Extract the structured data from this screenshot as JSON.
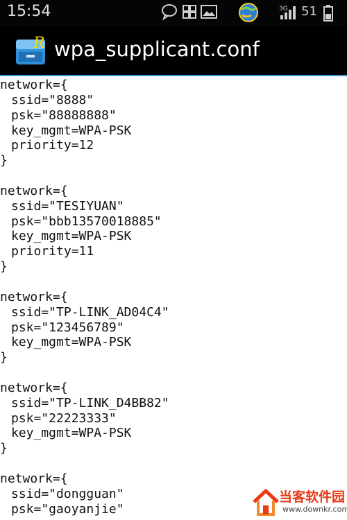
{
  "status_bar": {
    "time": "15:54",
    "icons": [
      "chat-bubble-icon",
      "app-grid-icon",
      "image-icon",
      "sync-globe-icon",
      "signal-3g-icon",
      "battery-icon"
    ],
    "network_label": "3G",
    "battery_level": "51"
  },
  "title_bar": {
    "app_icon": "file-manager-icon",
    "title": "wpa_supplicant.conf",
    "accent_color": "#3c9dd8"
  },
  "file_lines": [
    {
      "text": "network={",
      "indent": false
    },
    {
      "text": "ssid=\"8888\"",
      "indent": true
    },
    {
      "text": "psk=\"88888888\"",
      "indent": true
    },
    {
      "text": "key_mgmt=WPA-PSK",
      "indent": true
    },
    {
      "text": "priority=12",
      "indent": true
    },
    {
      "text": "}",
      "indent": false
    },
    {
      "text": "",
      "indent": false
    },
    {
      "text": "network={",
      "indent": false
    },
    {
      "text": "ssid=\"TESIYUAN\"",
      "indent": true
    },
    {
      "text": "psk=\"bbb13570018885\"",
      "indent": true
    },
    {
      "text": "key_mgmt=WPA-PSK",
      "indent": true
    },
    {
      "text": "priority=11",
      "indent": true
    },
    {
      "text": "}",
      "indent": false
    },
    {
      "text": "",
      "indent": false
    },
    {
      "text": "network={",
      "indent": false
    },
    {
      "text": "ssid=\"TP-LINK_AD04C4\"",
      "indent": true
    },
    {
      "text": "psk=\"123456789\"",
      "indent": true
    },
    {
      "text": "key_mgmt=WPA-PSK",
      "indent": true
    },
    {
      "text": "}",
      "indent": false
    },
    {
      "text": "",
      "indent": false
    },
    {
      "text": "network={",
      "indent": false
    },
    {
      "text": "ssid=\"TP-LINK_D4BB82\"",
      "indent": true
    },
    {
      "text": "psk=\"22223333\"",
      "indent": true
    },
    {
      "text": "key_mgmt=WPA-PSK",
      "indent": true
    },
    {
      "text": "}",
      "indent": false
    },
    {
      "text": "",
      "indent": false
    },
    {
      "text": "network={",
      "indent": false
    },
    {
      "text": "ssid=\"dongguan\"",
      "indent": true
    },
    {
      "text": "psk=\"gaoyanjie\"",
      "indent": true
    }
  ],
  "watermark": {
    "title": "当客软件园",
    "url": "www.downkr.com",
    "color": "#e83a14"
  }
}
